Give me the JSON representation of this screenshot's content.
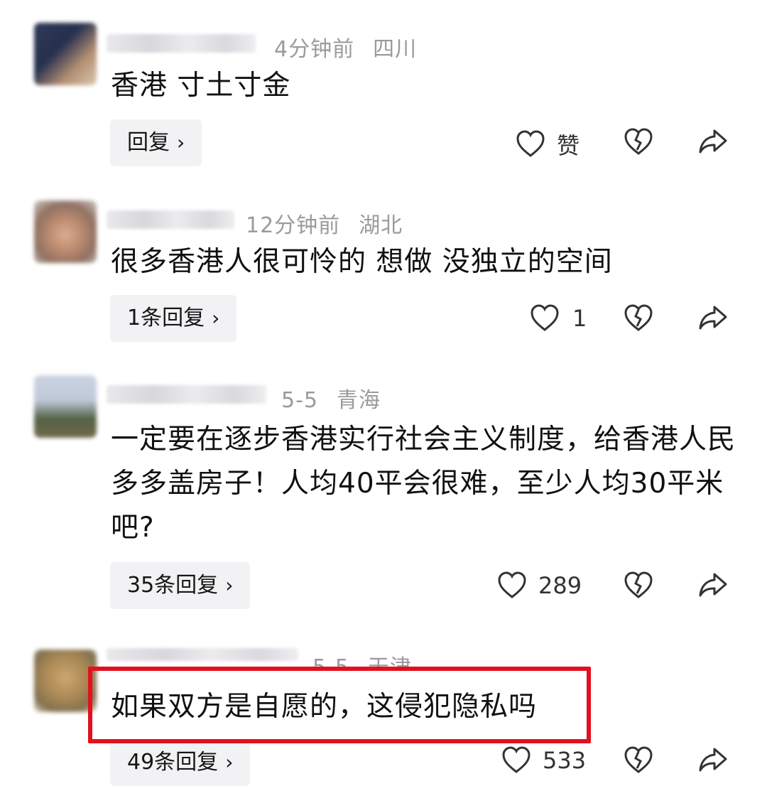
{
  "comments": [
    {
      "time": "4分钟前",
      "location": "四川",
      "text": "香港 寸土寸金",
      "reply_label": "回复",
      "like_label": "赞"
    },
    {
      "time": "12分钟前",
      "location": "湖北",
      "text": "很多香港人很可怜的 想做 没独立的空间",
      "reply_label": "1条回复",
      "like_label": "1"
    },
    {
      "time": "5-5",
      "location": "青海",
      "text": "一定要在逐步香港实行社会主义制度，给香港人民多多盖房子！人均40平会很难，至少人均30平米吧?",
      "reply_label": "35条回复",
      "like_label": "289"
    },
    {
      "time": "5-5",
      "location": "天津",
      "text": "如果双方是自愿的，这侵犯隐私吗",
      "reply_label": "49条回复",
      "like_label": "533"
    }
  ],
  "chevron": "›",
  "icons": [
    "heart-icon",
    "broken-heart-icon",
    "share-icon"
  ],
  "colors": {
    "highlight": "#e3101e",
    "meta": "#9a9aa0",
    "button_bg": "#f2f2f4"
  }
}
